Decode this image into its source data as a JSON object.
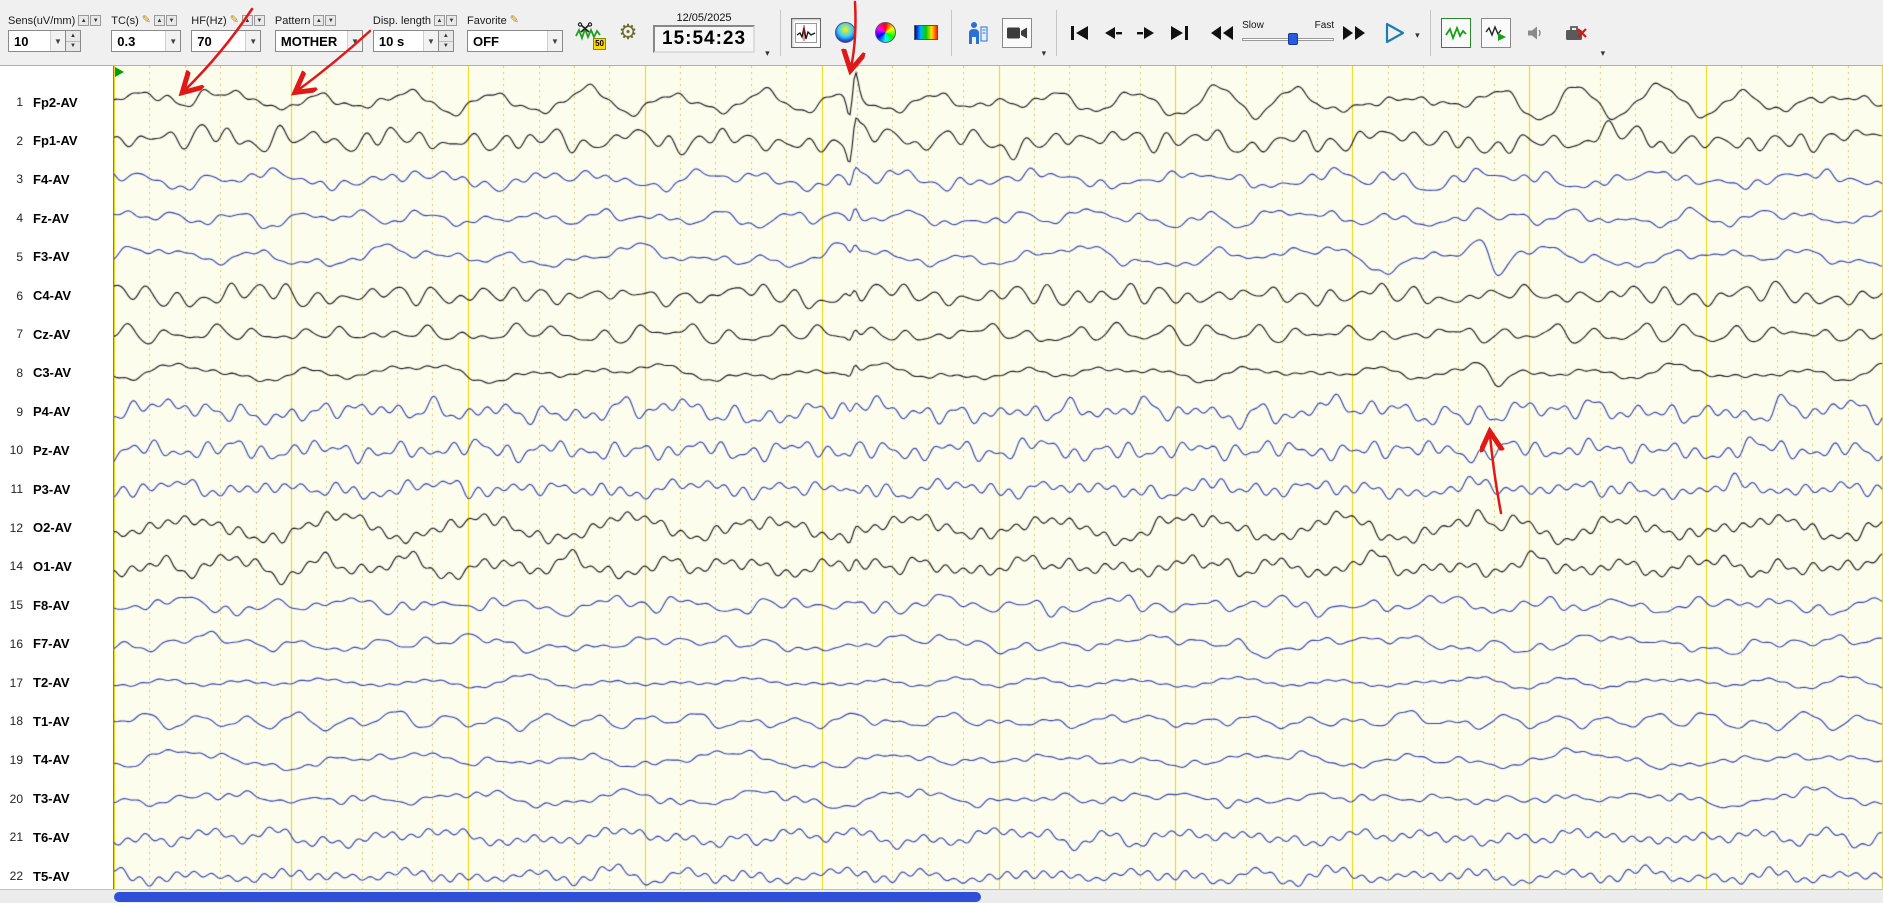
{
  "toolbar": {
    "sens": {
      "label": "Sens(uV/mm)",
      "value": "10"
    },
    "tc": {
      "label": "TC(s)",
      "value": "0.3"
    },
    "hf": {
      "label": "HF(Hz)",
      "value": "70"
    },
    "pattern": {
      "label": "Pattern",
      "value": "MOTHER"
    },
    "disp_length": {
      "label": "Disp. length",
      "value": "10 s"
    },
    "favorite": {
      "label": "Favorite",
      "value": "OFF"
    },
    "notch_badge": "50",
    "datetime": {
      "date": "12/05/2025",
      "time": "15:54:23"
    },
    "speed_slider": {
      "slow": "Slow",
      "fast": "Fast",
      "position": 0.58
    }
  },
  "channels": [
    {
      "num": "1",
      "label": "Fp2-AV",
      "color": "black"
    },
    {
      "num": "2",
      "label": "Fp1-AV",
      "color": "black"
    },
    {
      "num": "3",
      "label": "F4-AV",
      "color": "blue"
    },
    {
      "num": "4",
      "label": "Fz-AV",
      "color": "blue"
    },
    {
      "num": "5",
      "label": "F3-AV",
      "color": "blue"
    },
    {
      "num": "6",
      "label": "C4-AV",
      "color": "black"
    },
    {
      "num": "7",
      "label": "Cz-AV",
      "color": "black"
    },
    {
      "num": "8",
      "label": "C3-AV",
      "color": "black"
    },
    {
      "num": "9",
      "label": "P4-AV",
      "color": "blue"
    },
    {
      "num": "10",
      "label": "Pz-AV",
      "color": "blue"
    },
    {
      "num": "11",
      "label": "P3-AV",
      "color": "blue"
    },
    {
      "num": "12",
      "label": "O2-AV",
      "color": "black"
    },
    {
      "num": "14",
      "label": "O1-AV",
      "color": "black"
    },
    {
      "num": "15",
      "label": "F8-AV",
      "color": "blue"
    },
    {
      "num": "16",
      "label": "F7-AV",
      "color": "blue"
    },
    {
      "num": "17",
      "label": "T2-AV",
      "color": "blue"
    },
    {
      "num": "18",
      "label": "T1-AV",
      "color": "blue"
    },
    {
      "num": "19",
      "label": "T4-AV",
      "color": "blue"
    },
    {
      "num": "20",
      "label": "T3-AV",
      "color": "blue"
    },
    {
      "num": "21",
      "label": "T6-AV",
      "color": "blue"
    },
    {
      "num": "22",
      "label": "T5-AV",
      "color": "blue"
    }
  ],
  "eeg": {
    "background": "#fdfdee",
    "grid_major": "#ecd400",
    "grid_minor": "#d9cc66",
    "trace_black": "#161616",
    "trace_blue": "#2f3fae",
    "seconds": 10,
    "amp_frontal": 7.5,
    "amp_default": 5.8,
    "amp_temporal": 5.0,
    "artifacts": {
      "spike_t": 0.4175,
      "slow_t": 0.777,
      "blink_t": [
        0.03,
        0.052,
        0.092
      ]
    }
  },
  "annotations": {
    "color": "#e01818"
  },
  "scrollbar": {
    "fraction": 0.49
  }
}
